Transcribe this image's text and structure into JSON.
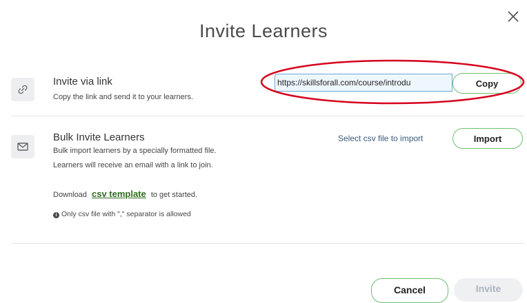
{
  "dialog": {
    "title": "Invite Learners",
    "close_icon": "close-icon"
  },
  "invite_link": {
    "icon": "link-icon",
    "title": "Invite via link",
    "description": "Copy the link and send it to your learners.",
    "url": "https://skillsforall.com/course/introdu",
    "copy_label": "Copy"
  },
  "bulk_invite": {
    "icon": "envelope-icon",
    "title": "Bulk Invite Learners",
    "description_line1": "Bulk import learners by a specially formatted file.",
    "description_line2": "Learners will receive an email with a link to join.",
    "select_label": "Select csv file to import",
    "import_label": "Import",
    "download_prefix": "Download",
    "download_link": "csv template",
    "download_suffix": "to get started.",
    "note": "Only csv file with \",\" separator is allowed"
  },
  "footer": {
    "cancel_label": "Cancel",
    "invite_label": "Invite"
  },
  "colors": {
    "button_border": "#6bbf6e",
    "annotation": "#d6001c",
    "link_green": "#2e6b1f",
    "field_border": "#6aa7d6"
  }
}
